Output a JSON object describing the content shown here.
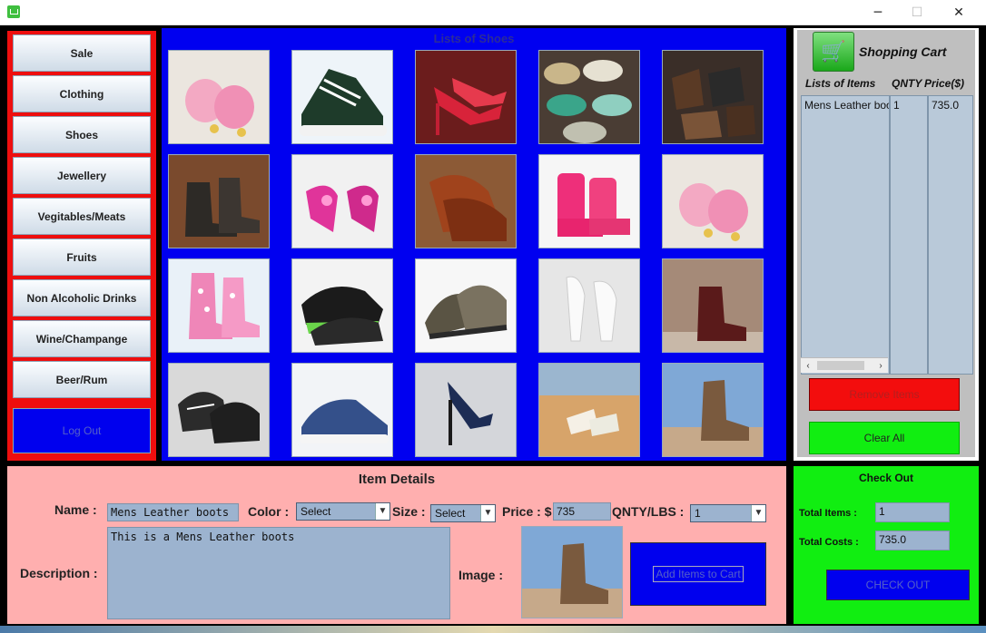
{
  "window": {
    "minimize": "─",
    "maximize": "☐",
    "close": "✕"
  },
  "sidebar": {
    "items": [
      {
        "label": "Sale"
      },
      {
        "label": "Clothing"
      },
      {
        "label": "Shoes"
      },
      {
        "label": "Jewellery"
      },
      {
        "label": "Vegitables/Meats"
      },
      {
        "label": "Fruits"
      },
      {
        "label": "Non Alcoholic Drinks"
      },
      {
        "label": "Wine/Champange"
      },
      {
        "label": "Beer/Rum"
      }
    ],
    "logout": "Log Out"
  },
  "grid": {
    "title": "Lists of Shoes"
  },
  "cart": {
    "title": "Shopping Cart",
    "headers": {
      "items": "Lists of Items",
      "qnty": "QNTY",
      "price": "Price($)"
    },
    "rows": [
      {
        "item": "Mens Leather boots",
        "qnty": "1",
        "price": "735.0"
      }
    ],
    "remove": "Remove Items",
    "clear": "Clear All"
  },
  "details": {
    "title": "Item Details",
    "name_label": "Name :",
    "name_value": "Mens Leather boots",
    "color_label": "Color :",
    "color_value": "Select",
    "size_label": "Size :",
    "size_value": "Select",
    "price_label": "Price : $",
    "price_value": "735",
    "qnty_label": "QNTY/LBS :",
    "qnty_value": "1",
    "desc_label": "Description :",
    "desc_value": "This is a Mens Leather boots",
    "image_label": "Image :",
    "add_button": "Add Items to Cart"
  },
  "checkout": {
    "title": "Check Out",
    "total_items_label": "Total Items :",
    "total_items_value": "1",
    "total_costs_label": "Total Costs :",
    "total_costs_value": "735.0",
    "button": "CHECK OUT"
  }
}
